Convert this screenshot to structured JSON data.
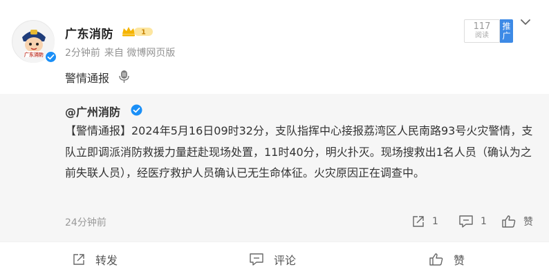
{
  "post": {
    "author": "广东消防",
    "crown_level": "1",
    "time": "2分钟前",
    "source": "来自 微博网页版",
    "reads": "117",
    "reads_label": "阅读",
    "promote_label": "推广",
    "text": "警情通报",
    "avatar_text": "广东消防"
  },
  "repost": {
    "author": "@广州消防",
    "text": "【警情通报】2024年5月16日09时32分，支队指挥中心接报荔湾区人民南路93号火灾警情，支队立即调派消防救援力量赶赴现场处置，11时40分，明火扑灭。现场搜救出1名人员（确认为之前失联人员），经医疗救护人员确认已无生命体征。火灾原因正在调查中。",
    "time": "24分钟前",
    "shares": "1",
    "comments": "1",
    "likes_label": "赞"
  },
  "footer": {
    "repost_label": "转发",
    "comment_label": "评论",
    "like_label": "赞"
  },
  "colors": {
    "accent": "#3d8ae6",
    "verified": "#1a8ff7",
    "crown": "#f5b400",
    "repost_bg": "#f6f6f6"
  },
  "icons": [
    "more-chevron-icon",
    "verified-icon",
    "crown-badge-icon",
    "microphone-icon",
    "share-icon",
    "comment-icon",
    "like-icon"
  ]
}
